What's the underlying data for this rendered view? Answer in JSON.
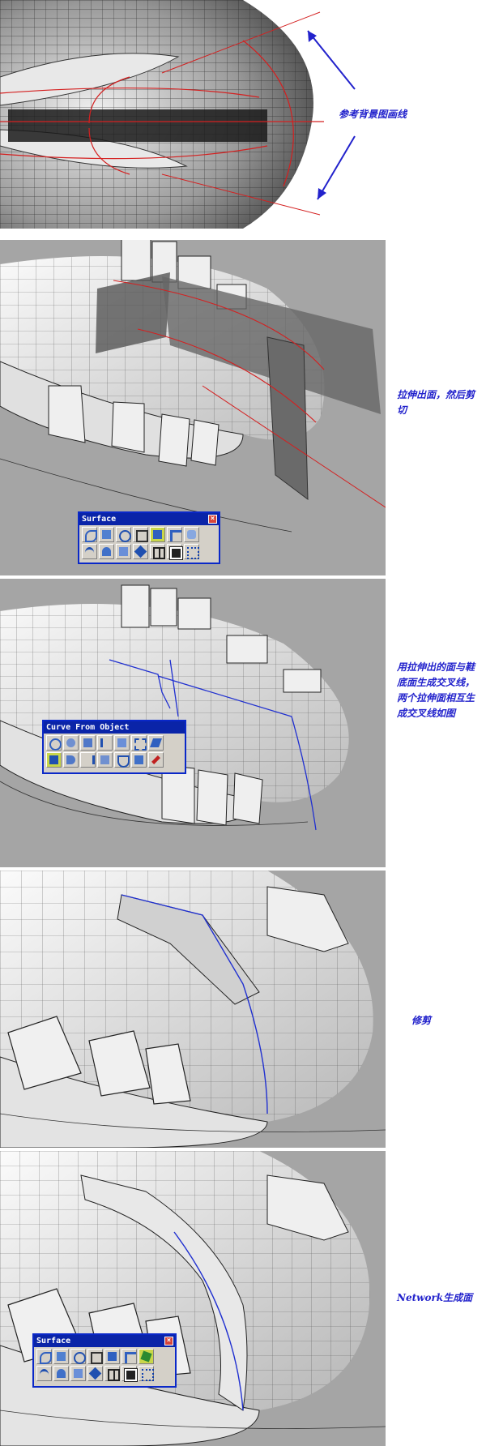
{
  "colors": {
    "annotation": "#2222cc",
    "curve_red": "#d42020",
    "curve_blue": "#2030d0",
    "viewport": "#a5a5a5",
    "toolbar_title": "#0a24a8"
  },
  "steps": [
    {
      "id": "reference",
      "note": "参考背景图画线"
    },
    {
      "id": "extrude",
      "note": "拉伸出面，然后剪切"
    },
    {
      "id": "intersect",
      "note": "用拉伸出的面与鞋底面生成交叉线，两个拉伸面相互生成交叉线如图"
    },
    {
      "id": "trim",
      "note": "修剪"
    },
    {
      "id": "network",
      "note": "Network生成面"
    }
  ],
  "toolbars": {
    "surface_a": {
      "title": "Surface",
      "close": "×",
      "icons": [
        "loft-icon",
        "extrude-icon",
        "revolve-icon",
        "planar-icon",
        "sweep-icon",
        "blend-icon",
        "offset-icon",
        "rail-icon",
        "patch-icon",
        "drape-icon",
        "network-icon",
        "grid-icon",
        "points-icon",
        "mesh-icon"
      ],
      "active": 4
    },
    "curve_from_object": {
      "title": "Curve From Object",
      "close": "×",
      "icons": [
        "duplicate-edge-icon",
        "duplicate-border-icon",
        "contour-icon",
        "section-icon",
        "isocurve-icon",
        "extract-icon",
        "project-icon",
        "intersect-icon",
        "silhouette-icon",
        "pull-icon",
        "wireframe-icon",
        "offset-curve-icon",
        "blend-curve-icon",
        "pen-icon"
      ],
      "active": 7
    },
    "surface_b": {
      "title": "Surface",
      "close": "×",
      "icons": [
        "loft-icon",
        "extrude-icon",
        "revolve-icon",
        "planar-icon",
        "sweep-icon",
        "blend-icon",
        "network-icon",
        "rail-icon",
        "patch-icon",
        "drape-icon",
        "offset-icon",
        "grid-icon",
        "points-icon",
        "mesh-icon"
      ],
      "active": 6
    }
  }
}
